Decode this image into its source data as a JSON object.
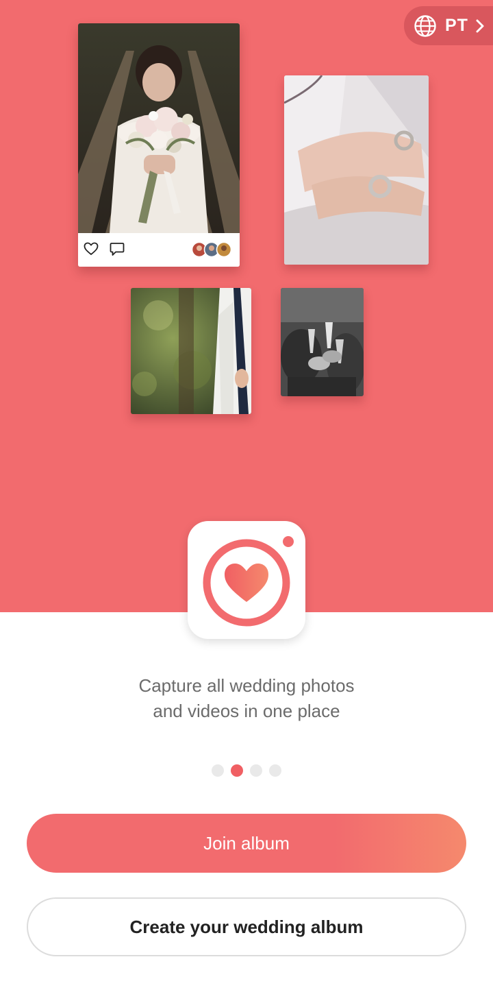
{
  "language": {
    "code": "PT",
    "icon": "globe-icon",
    "arrow_icon": "chevron-right-icon"
  },
  "featured_post": {
    "like_icon": "heart-outline-icon",
    "comment_icon": "comment-icon",
    "avatars_icon": "guest-avatars"
  },
  "app_icon": "camera-heart-logo",
  "onboarding": {
    "tagline_line1": "Capture all wedding photos",
    "tagline_line2": "and videos in one place",
    "page_count": 4,
    "active_page": 2
  },
  "actions": {
    "join_label": "Join album",
    "create_label": "Create your wedding album"
  },
  "colors": {
    "brand": "#f26b6e",
    "brand_gradient_end": "#f5896d",
    "language_pill": "#d9575d",
    "dot_inactive": "#e9e9e9",
    "text_muted": "#6b6b6b"
  }
}
